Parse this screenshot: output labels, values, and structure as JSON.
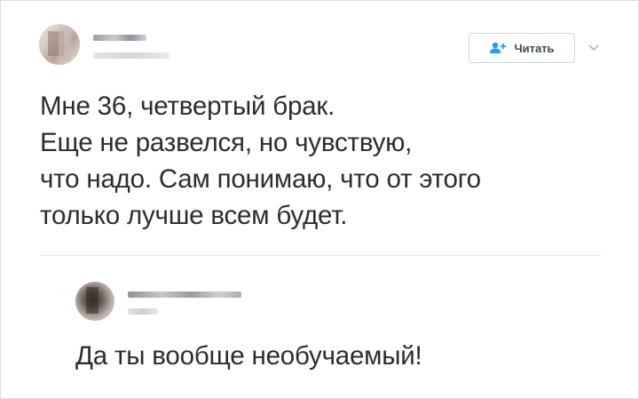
{
  "tweet": {
    "follow_label": "Читать",
    "lines": [
      "Мне 36, четвертый брак.",
      "Еще не развелся, но чувствую,",
      "что надо. Сам понимаю, что от этого",
      "только лучше всем будет."
    ]
  },
  "reply": {
    "text": "Да ты вообще необучаемый!"
  },
  "icons": {
    "follow": "add-user-icon",
    "more": "chevron-down-icon"
  },
  "colors": {
    "accent": "#1da1f2",
    "text": "#2a2d30",
    "button_text": "#3d4852",
    "border": "#c9d6e2"
  }
}
